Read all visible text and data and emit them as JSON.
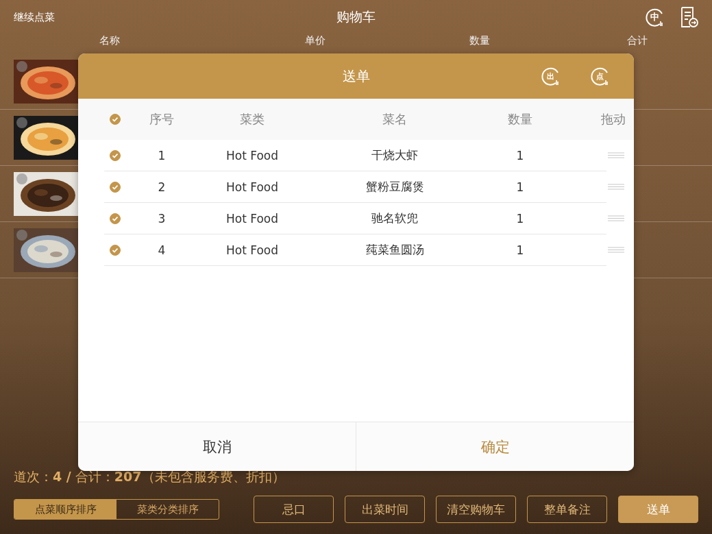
{
  "top_bar": {
    "back_link": "继续点菜",
    "title": "购物车",
    "language_toggle": "中"
  },
  "cart": {
    "columns": [
      "名称",
      "单价",
      "数量",
      "合计"
    ],
    "items": [
      {
        "kind": "picture"
      },
      {
        "kind": "picture"
      },
      {
        "kind": "picture"
      },
      {
        "kind": "picture"
      }
    ]
  },
  "dialog": {
    "title": "送单",
    "header_actions": [
      {
        "label": "出"
      },
      {
        "label": "点"
      }
    ],
    "select_all": {
      "checked": true
    },
    "columns": [
      "序号",
      "菜类",
      "菜名",
      "数量",
      "拖动"
    ],
    "rows": [
      {
        "checked": true,
        "index": "1",
        "category": "Hot Food",
        "name": "干烧大虾",
        "quantity": "1"
      },
      {
        "checked": true,
        "index": "2",
        "category": "Hot Food",
        "name": "蟹粉豆腐煲",
        "quantity": "1"
      },
      {
        "checked": true,
        "index": "3",
        "category": "Hot Food",
        "name": "驰名软兜",
        "quantity": "1"
      },
      {
        "checked": true,
        "index": "4",
        "category": "Hot Food",
        "name": "莼菜鱼圆汤",
        "quantity": "1"
      }
    ],
    "buttons": [
      {
        "label": "取消",
        "kind": "cancel"
      },
      {
        "label": "确定",
        "kind": "confirm"
      }
    ]
  },
  "summary": "道次：**4 /** 合计：**207**（未包含服务费、折扣）",
  "sort_tabs": [
    {
      "label": "点菜顺序排序",
      "selected": true
    },
    {
      "label": "菜类分类排序",
      "selected": false
    }
  ],
  "actions": [
    {
      "label": "忌口",
      "kind": "outline"
    },
    {
      "label": "出菜时间",
      "kind": "outline"
    },
    {
      "label": "清空购物车",
      "kind": "outline"
    },
    {
      "label": "整单备注",
      "kind": "outline"
    },
    {
      "label": "送单",
      "kind": "primary"
    }
  ]
}
